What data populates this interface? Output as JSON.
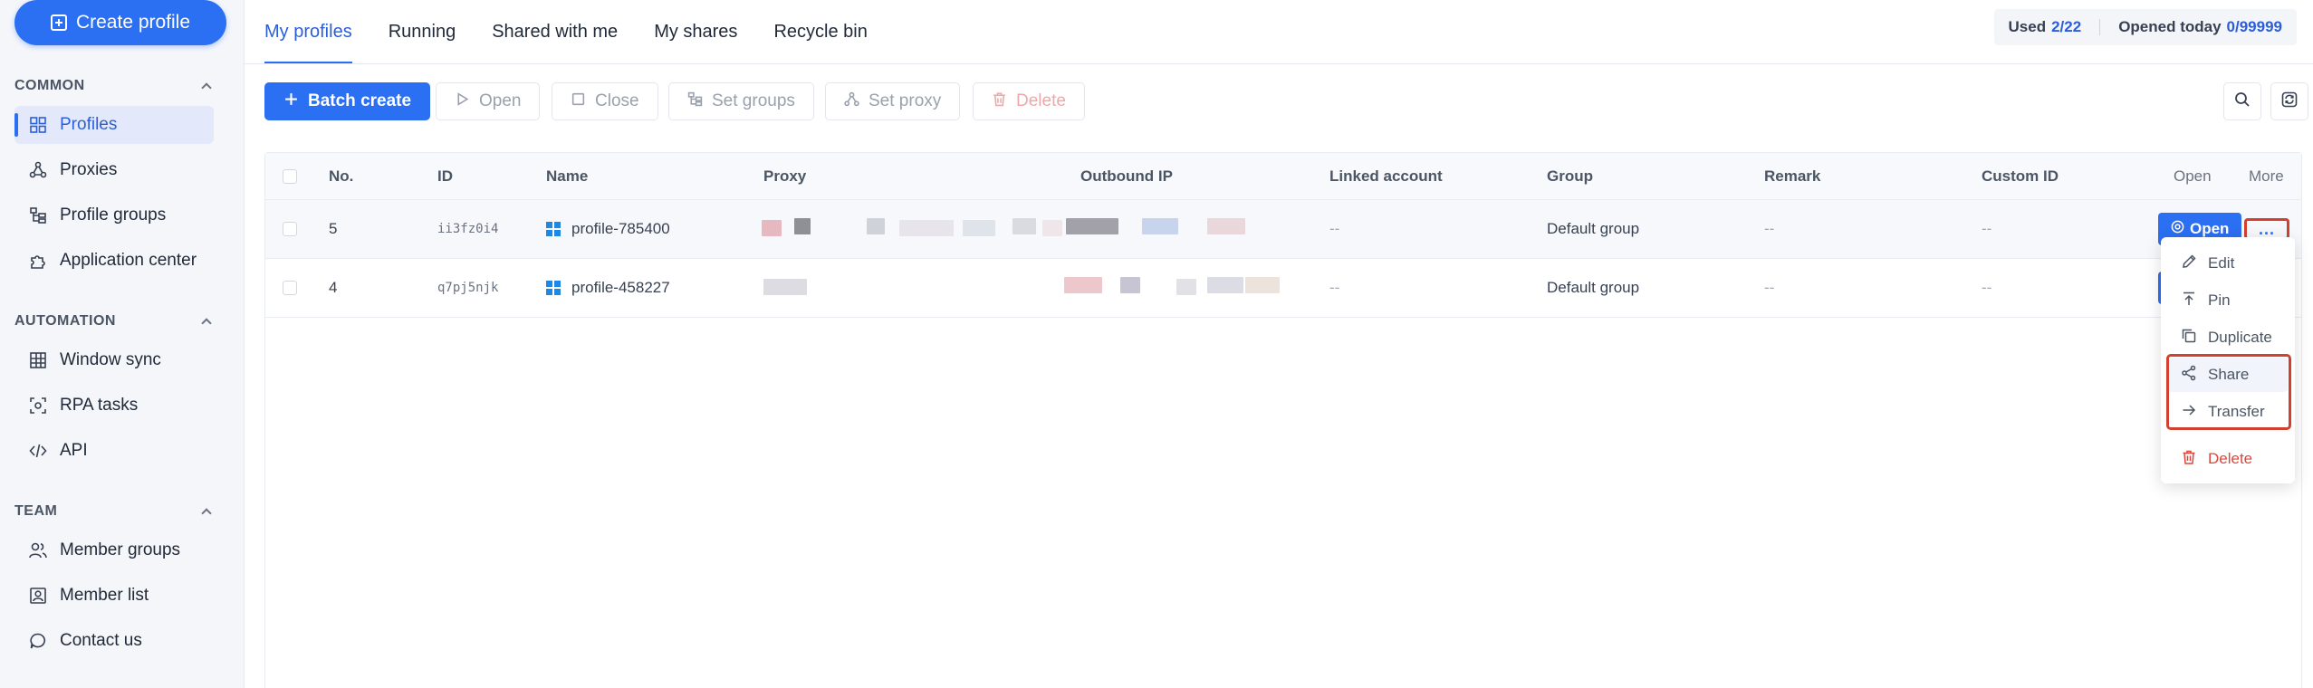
{
  "sidebar": {
    "create_label": "Create profile",
    "sections": [
      {
        "title": "COMMON",
        "items": [
          "Profiles",
          "Proxies",
          "Profile groups",
          "Application center"
        ]
      },
      {
        "title": "AUTOMATION",
        "items": [
          "Window sync",
          "RPA tasks",
          "API"
        ]
      },
      {
        "title": "TEAM",
        "items": [
          "Member groups",
          "Member list",
          "Contact us"
        ]
      }
    ],
    "active_item": "Profiles"
  },
  "tabs": [
    "My profiles",
    "Running",
    "Shared with me",
    "My shares",
    "Recycle bin"
  ],
  "active_tab": "My profiles",
  "quota": {
    "used_label": "Used",
    "used_value": "2/22",
    "opened_label": "Opened today",
    "opened_value": "0/99999"
  },
  "toolbar": {
    "batch_create": "Batch create",
    "open": "Open",
    "close": "Close",
    "set_groups": "Set groups",
    "set_proxy": "Set proxy",
    "delete": "Delete"
  },
  "table": {
    "columns": [
      "No.",
      "ID",
      "Name",
      "Proxy",
      "Outbound IP",
      "Linked account",
      "Group",
      "Remark",
      "Custom ID",
      "Open",
      "More"
    ],
    "rows": [
      {
        "no": "5",
        "id": "ii3fz0i4",
        "name": "profile-785400",
        "linked": "--",
        "group": "Default group",
        "remark": "--",
        "custom": "--",
        "open": "Open"
      },
      {
        "no": "4",
        "id": "q7pj5njk",
        "name": "profile-458227",
        "linked": "--",
        "group": "Default group",
        "remark": "--",
        "custom": "--",
        "open": ""
      }
    ],
    "more_label": "..."
  },
  "menu": {
    "items": [
      "Edit",
      "Pin",
      "Duplicate",
      "Share",
      "Transfer",
      "Delete"
    ],
    "hovered": "Share"
  },
  "colors": {
    "primary": "#2b6ff2",
    "danger": "#e0453a",
    "highlight": "#d2402f"
  }
}
